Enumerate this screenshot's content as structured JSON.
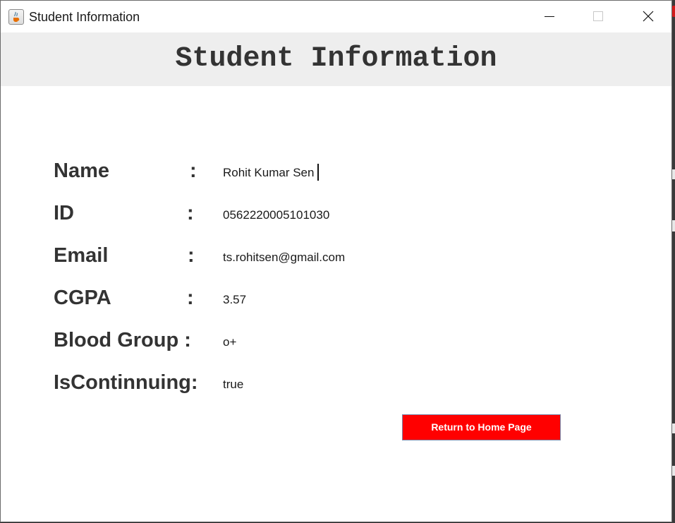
{
  "window": {
    "title": "Student Information"
  },
  "header": {
    "title": "Student Information"
  },
  "fields": [
    {
      "label": "Name",
      "separator": ":",
      "value": "Rohit Kumar Sen"
    },
    {
      "label": "ID",
      "separator": ":",
      "value": "0562220005101030"
    },
    {
      "label": "Email",
      "separator": ":",
      "value": "ts.rohitsen@gmail.com"
    },
    {
      "label": "CGPA",
      "separator": ":",
      "value": "3.57"
    },
    {
      "label": "Blood Group :",
      "separator": "",
      "value": "o+"
    },
    {
      "label": "IsContinnuing:",
      "separator": "",
      "value": "true"
    }
  ],
  "actions": {
    "return_label": "Return to Home Page"
  },
  "colors": {
    "header_band": "#eeeeee",
    "button_bg": "#ff0000",
    "button_text": "#ffffff",
    "label_text": "#333333"
  },
  "icons": {
    "app": "java-cup-icon",
    "minimize": "minimize-icon",
    "maximize": "maximize-icon",
    "close": "close-icon"
  }
}
